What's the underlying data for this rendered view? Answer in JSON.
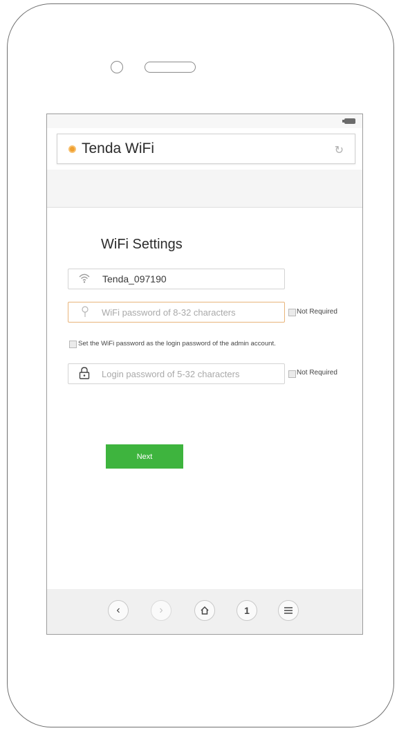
{
  "browser": {
    "title": "Tenda WiFi",
    "site_icon": "tenda-logo-icon",
    "reload_icon": "reload-icon"
  },
  "page": {
    "title": "WiFi Settings"
  },
  "form": {
    "ssid_value": "Tenda_097190",
    "wifi_password_placeholder": "WiFi password of 8-32 characters",
    "wifi_not_required_label": "Not Required",
    "sync_password_label": "Set the WiFi password as the login password of the admin account.",
    "login_password_placeholder": "Login password of 5-32 characters",
    "login_not_required_label": "Not Required"
  },
  "actions": {
    "next_label": "Next"
  },
  "navbar": {
    "tab_count": "1"
  },
  "colors": {
    "accent_button": "#3eb43e",
    "focus_border": "#e8b47a",
    "site_icon": "#f0a030"
  }
}
